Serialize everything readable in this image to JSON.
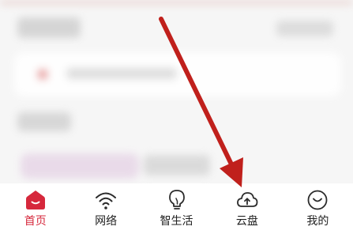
{
  "tabbar": {
    "accent_color": "#d6283c",
    "tabs": [
      {
        "label": "首页",
        "icon": "home-icon",
        "active": true
      },
      {
        "label": "网络",
        "icon": "wifi-icon",
        "active": false
      },
      {
        "label": "智生活",
        "icon": "lightbulb-icon",
        "active": false
      },
      {
        "label": "云盘",
        "icon": "cloud-upload-icon",
        "active": false
      },
      {
        "label": "我的",
        "icon": "profile-icon",
        "active": false
      }
    ]
  },
  "annotation": {
    "color": "#c0201c",
    "points_to": "云盘"
  }
}
